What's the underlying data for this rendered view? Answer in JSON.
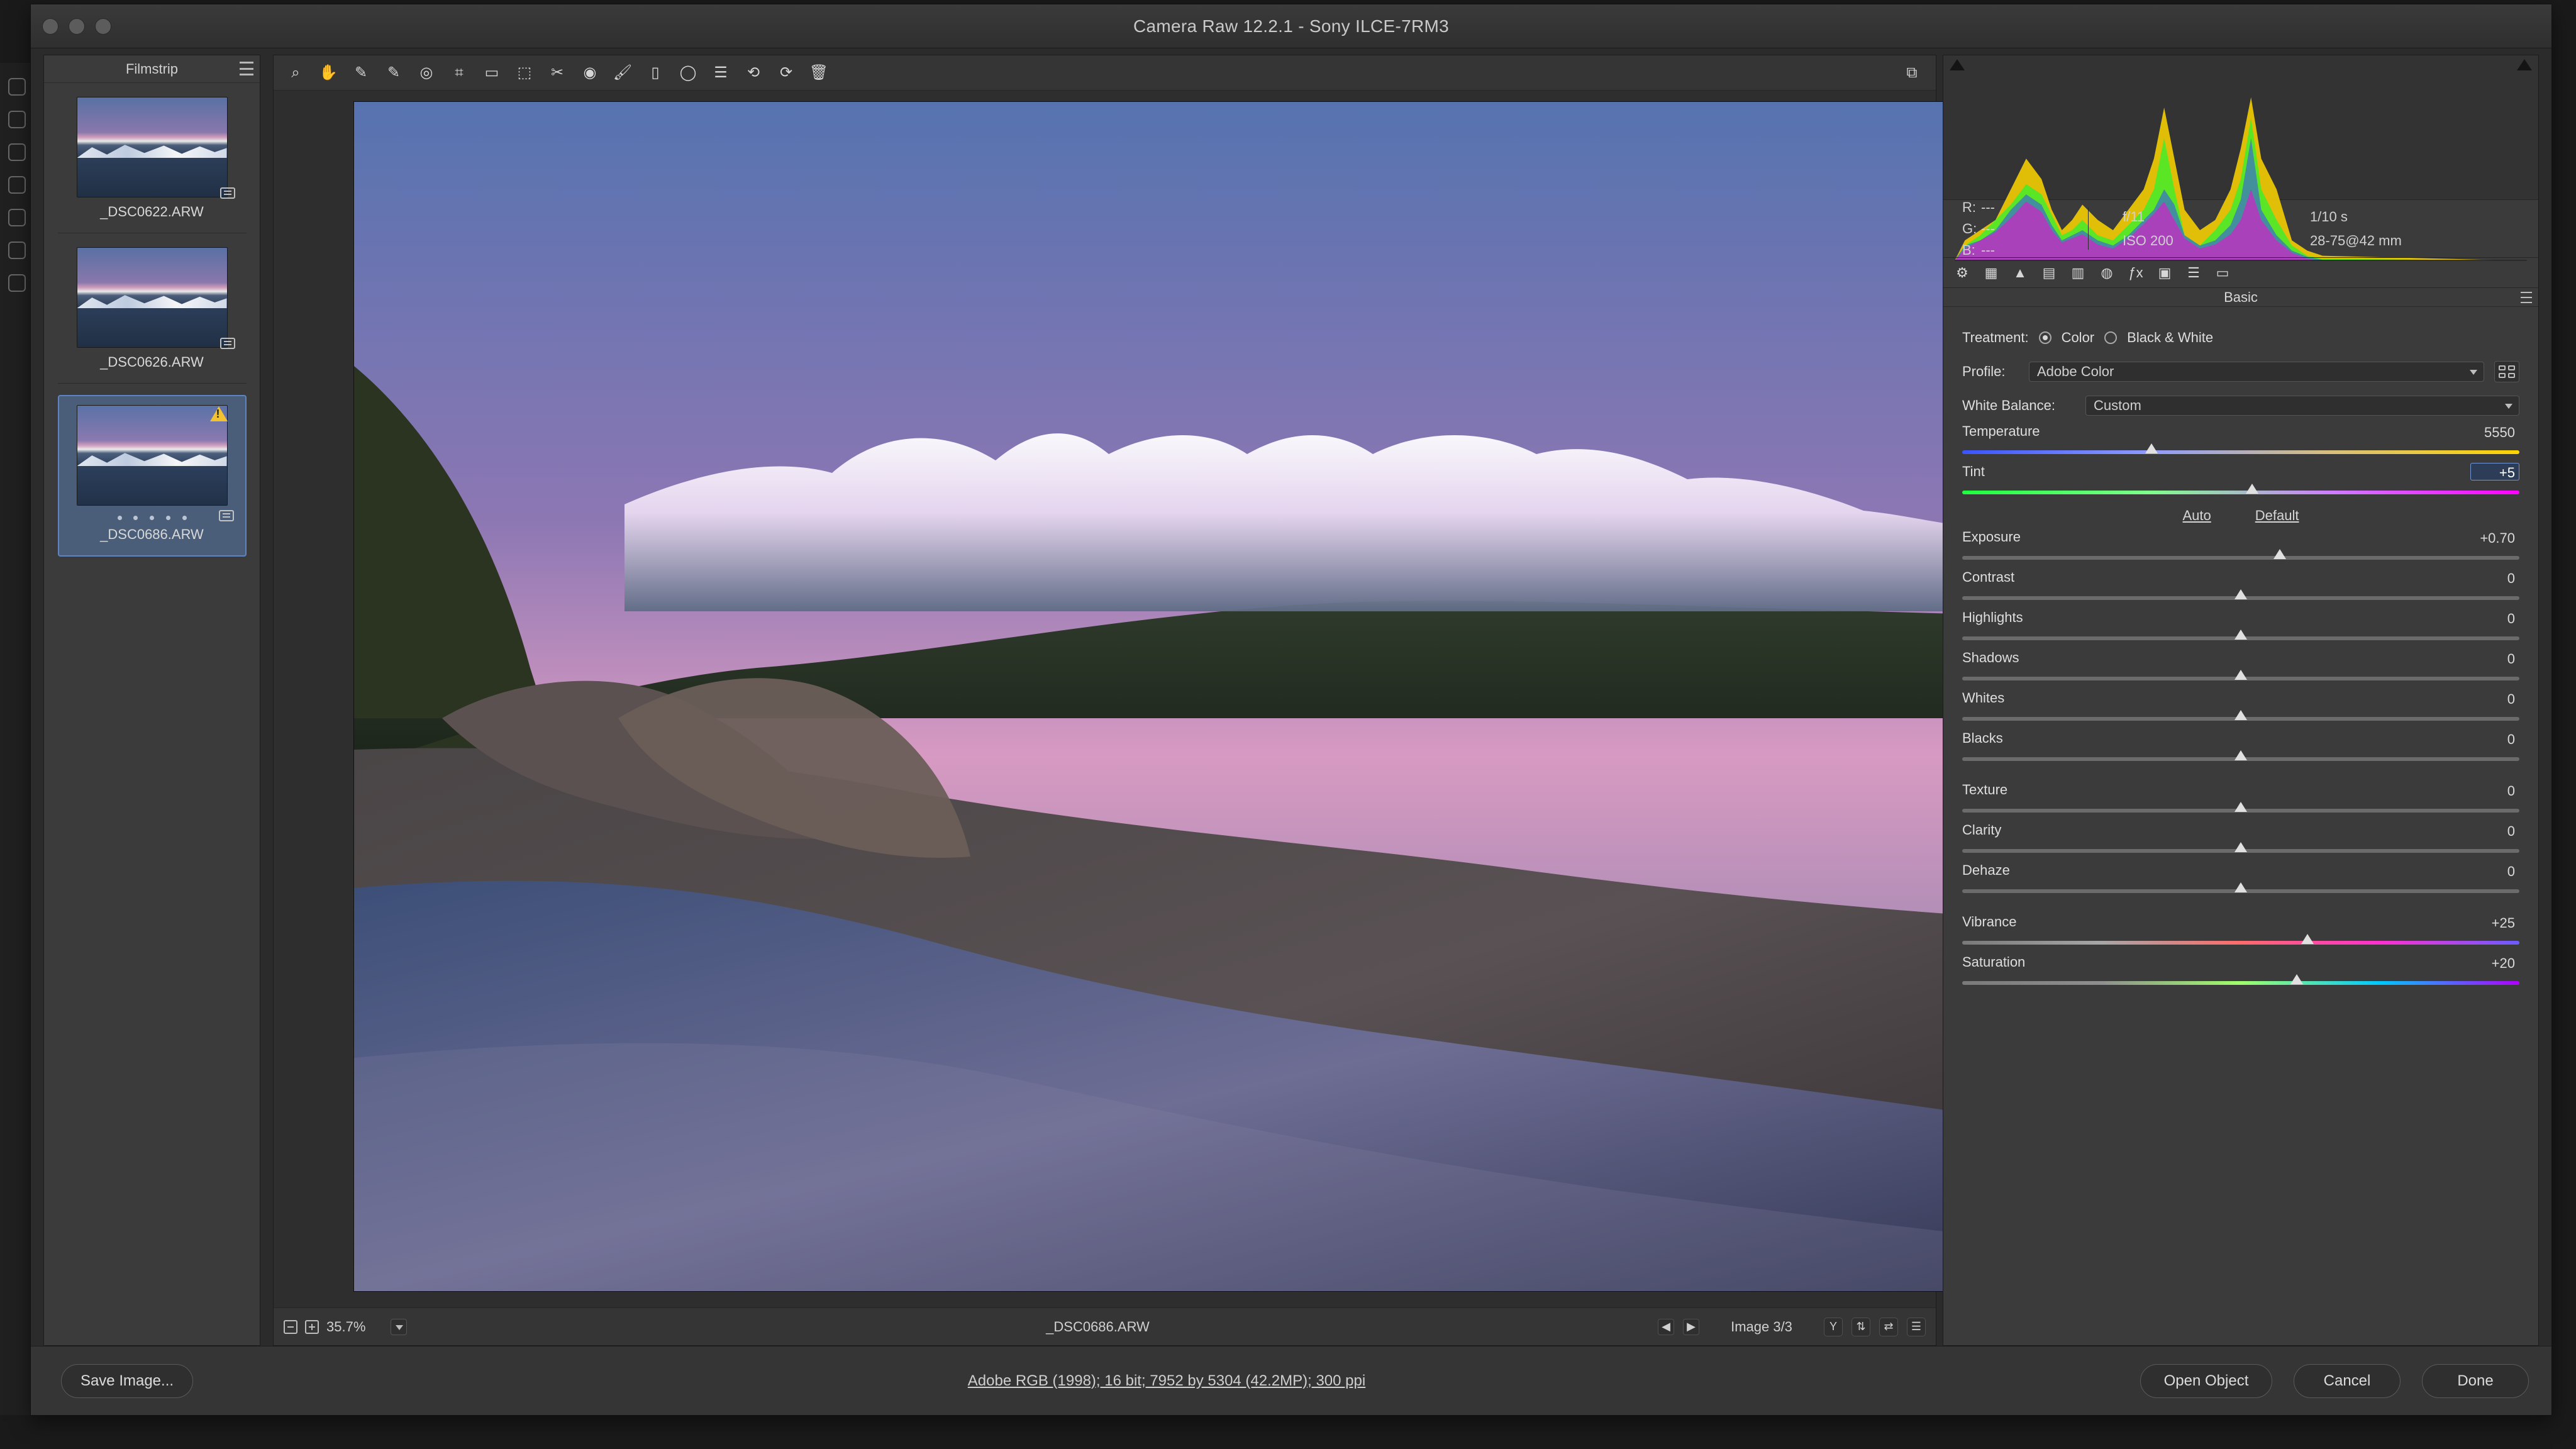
{
  "window": {
    "title": "Camera Raw 12.2.1  -  Sony ILCE-7RM3"
  },
  "filmstrip": {
    "title": "Filmstrip",
    "items": [
      {
        "name": "_DSC0622.ARW",
        "selected": false,
        "warning": false
      },
      {
        "name": "_DSC0626.ARW",
        "selected": false,
        "warning": false
      },
      {
        "name": "_DSC0686.ARW",
        "selected": true,
        "warning": true
      }
    ]
  },
  "toolbar": {
    "icons": [
      "zoom-icon",
      "hand-icon",
      "white-balance-icon",
      "color-sampler-icon",
      "target-adjust-icon",
      "crop-icon",
      "straighten-icon",
      "transform-icon",
      "spot-removal-icon",
      "redeye-icon",
      "adjustment-brush-icon",
      "graduated-filter-icon",
      "radial-filter-icon",
      "preferences-icon",
      "rotate-left-icon",
      "rotate-right-icon",
      "trash-icon"
    ],
    "right_icon": "open-in-new-window-icon"
  },
  "viewer": {
    "zoom": "35.7%",
    "file_name": "_DSC0686.ARW",
    "image_count": "Image 3/3"
  },
  "right_panel": {
    "rgb": {
      "r": "---",
      "g": "---",
      "b": "---"
    },
    "camera": {
      "aperture": "f/11",
      "shutter": "1/10 s",
      "iso": "ISO 200",
      "lens": "28-75@42 mm"
    },
    "section": "Basic",
    "treatment": {
      "label": "Treatment:",
      "color": "Color",
      "bw": "Black & White",
      "selected": "Color"
    },
    "profile": {
      "label": "Profile:",
      "value": "Adobe Color"
    },
    "white_balance": {
      "label": "White Balance:",
      "value": "Custom"
    },
    "sliders": [
      {
        "key": "temperature",
        "label": "Temperature",
        "value": "5550",
        "pos": 0.34,
        "class": "temp"
      },
      {
        "key": "tint",
        "label": "Tint",
        "value": "+5",
        "pos": 0.52,
        "class": "tint",
        "active": true
      },
      {
        "key": "exposure",
        "label": "Exposure",
        "value": "+0.70",
        "pos": 0.57
      },
      {
        "key": "contrast",
        "label": "Contrast",
        "value": "0",
        "pos": 0.5
      },
      {
        "key": "highlights",
        "label": "Highlights",
        "value": "0",
        "pos": 0.5
      },
      {
        "key": "shadows",
        "label": "Shadows",
        "value": "0",
        "pos": 0.5
      },
      {
        "key": "whites",
        "label": "Whites",
        "value": "0",
        "pos": 0.5
      },
      {
        "key": "blacks",
        "label": "Blacks",
        "value": "0",
        "pos": 0.5
      },
      {
        "key": "texture",
        "label": "Texture",
        "value": "0",
        "pos": 0.5
      },
      {
        "key": "clarity",
        "label": "Clarity",
        "value": "0",
        "pos": 0.5
      },
      {
        "key": "dehaze",
        "label": "Dehaze",
        "value": "0",
        "pos": 0.5
      },
      {
        "key": "vibrance",
        "label": "Vibrance",
        "value": "+25",
        "pos": 0.62,
        "class": "vib"
      },
      {
        "key": "saturation",
        "label": "Saturation",
        "value": "+20",
        "pos": 0.6,
        "class": "sat"
      }
    ],
    "links": {
      "auto": "Auto",
      "default": "Default"
    }
  },
  "bottom_bar": {
    "save": "Save Image...",
    "info": "Adobe RGB (1998); 16 bit; 7952 by 5304 (42.2MP); 300 ppi",
    "open": "Open Object",
    "cancel": "Cancel",
    "done": "Done"
  }
}
